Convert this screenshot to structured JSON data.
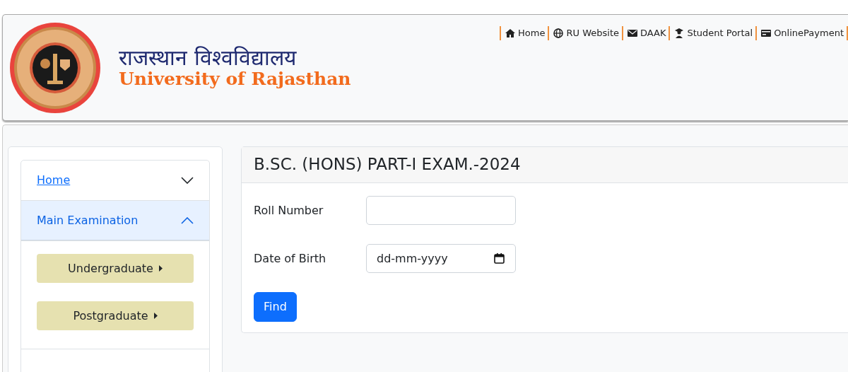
{
  "header": {
    "title_hindi": "राजस्थान  विश्वविद्यालय",
    "title_english": "University of Rajasthan",
    "links": [
      {
        "label": "Home"
      },
      {
        "label": "RU Website"
      },
      {
        "label": "DAAK"
      },
      {
        "label": "Student Portal"
      },
      {
        "label": "OnlinePayment"
      }
    ]
  },
  "sidebar": {
    "items": [
      {
        "label": "Home",
        "kind": "link",
        "expanded": false
      },
      {
        "label": "Main Examination",
        "kind": "heading",
        "expanded": true,
        "children": [
          {
            "label": "Undergraduate"
          },
          {
            "label": "Postgraduate"
          }
        ]
      }
    ]
  },
  "form": {
    "title": "B.SC. (HONS) PART-I EXAM.-2024",
    "fields": [
      {
        "label": "Roll Number",
        "kind": "text"
      },
      {
        "label": "Date of Birth",
        "kind": "date",
        "placeholder": "dd-mm-yyyy"
      }
    ],
    "button": "Find"
  }
}
